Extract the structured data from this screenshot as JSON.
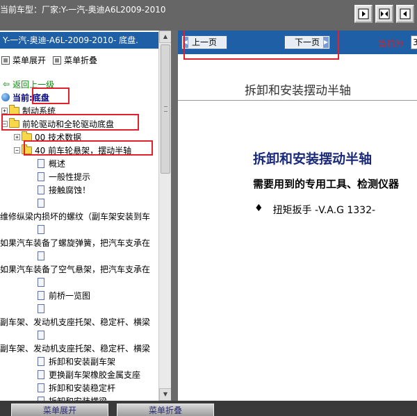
{
  "title_bar": {
    "text": "当前车型：厂家:Y-一汽-奥迪A6L2009-2010"
  },
  "left_pane": {
    "header": "Y-一汽-奥迪-A6L-2009-2010- 底盘.",
    "menu_expand": "菜单展开",
    "menu_collapse": "菜单折叠",
    "tree": {
      "back": "返回上一级",
      "current_label": "当前:",
      "current_value": "底盘",
      "brake": "制动系统",
      "fwd_awd": "前轮驱动和全轮驱动底盘",
      "tech_data": "00 技术数据",
      "front_susp": "40 前车轮悬架，摆动半轴",
      "overview": "概述",
      "general": "一般性提示",
      "corrosion": "接触腐蚀！",
      "repair_thread": "维修纵梁内损坏的螺纹（副车架安装到车",
      "coil_spring": "如果汽车装备了螺旋弹簧，把汽车支承在",
      "air_susp": "如果汽车装备了空气悬架，把汽车支承在",
      "axle_overview": "前桥一览图",
      "subframe1": "副车架、发动机支座托架、稳定杆、横梁",
      "subframe2": "副车架、发动机支座托架、稳定杆、横梁",
      "remove_subframe": "拆卸和安装副车架",
      "replace_bushing": "更换副车架橡胶金属支座",
      "remove_stabilizer": "拆卸和安装稳定杆",
      "remove_crossbeam": "拆卸和安装横梁"
    }
  },
  "right_pane": {
    "prev_page": "上一页",
    "next_page": "下一页",
    "current_page_label": "当前为",
    "current_page_value": "3",
    "doc_header": "拆卸和安装摆动半轴",
    "doc_title": "拆卸和安装摆动半轴",
    "doc_subtitle": "需要用到的专用工具、检测仪器",
    "tool_bullet": "♦",
    "tool_item": "扭矩扳手 -V.A.G 1332-"
  },
  "bottom_bar": {
    "menu_expand": "菜单展开",
    "menu_collapse": "菜单折叠"
  },
  "colors": {
    "header_blue": "#1f5fa6",
    "highlight_red": "#e0202a",
    "title_navy": "#1a2a7a",
    "top_bar_gray": "#666666"
  }
}
